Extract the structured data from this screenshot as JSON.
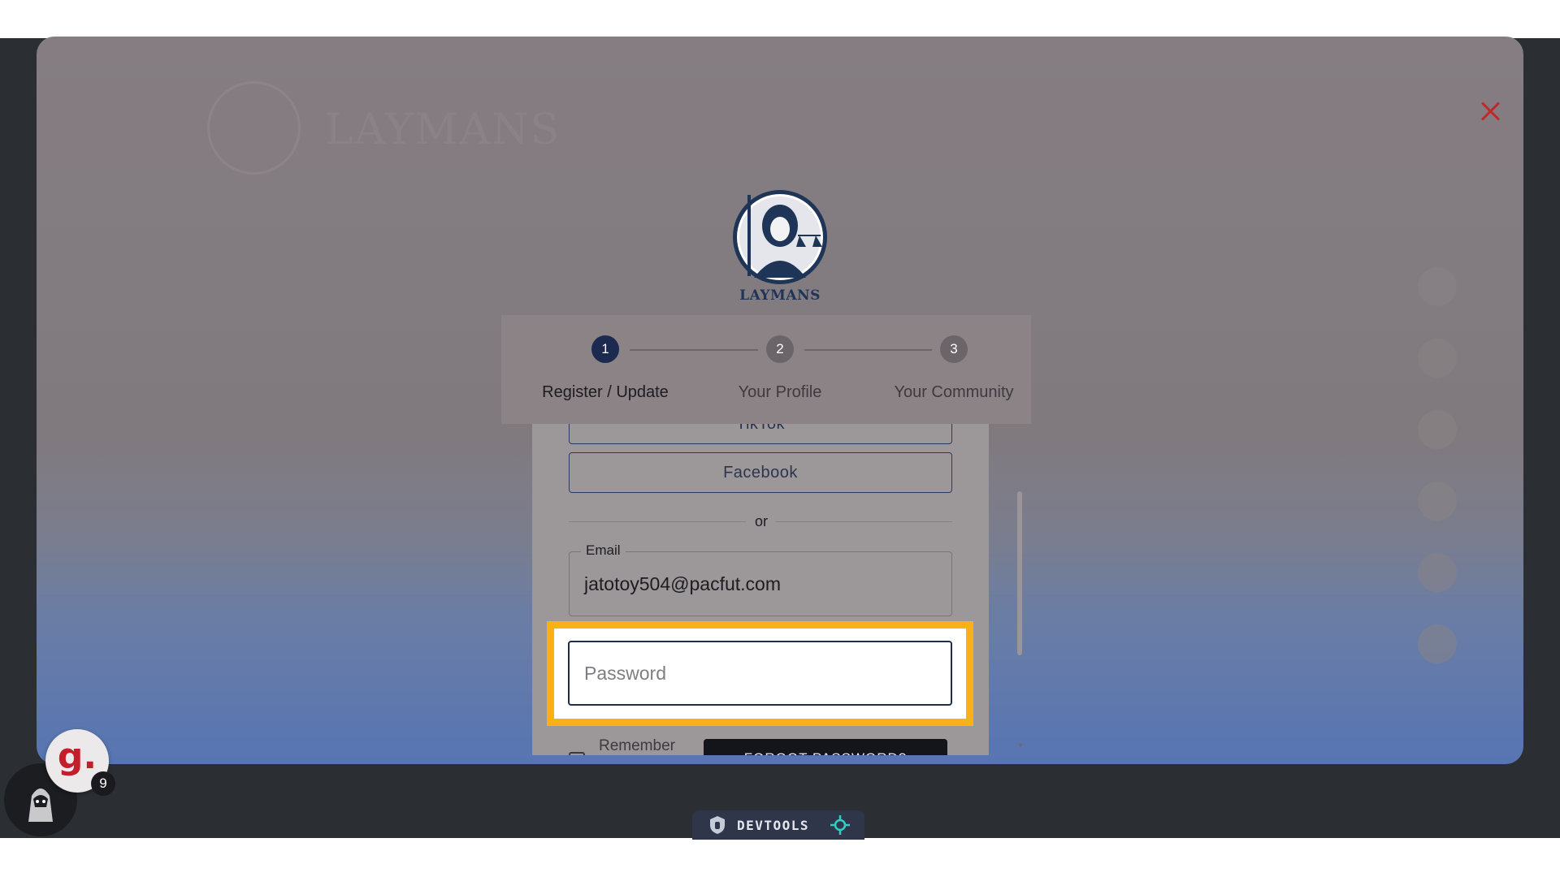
{
  "logo": {
    "text": "LAYMANS"
  },
  "background": {
    "brand_text": "LAYMANS"
  },
  "stepper": {
    "steps": [
      {
        "number": "1",
        "label": "Register / Update",
        "active": true
      },
      {
        "number": "2",
        "label": "Your Profile",
        "active": false
      },
      {
        "number": "3",
        "label": "Your Community",
        "active": false
      }
    ]
  },
  "form": {
    "tiktok_label": "TikTok",
    "facebook_label": "Facebook",
    "divider_text": "or",
    "email_label": "Email",
    "email_value": "jatotoy504@pacfut.com",
    "password_placeholder": "Password",
    "remember_label": "Remember",
    "forgot_label": "FORGOT PASSWORD?"
  },
  "grammarly": {
    "glyph": "g.",
    "count": "9"
  },
  "devtools": {
    "label": "DEVTOOLS"
  },
  "colors": {
    "step_active": "#1b2a4e",
    "step_inactive": "#6b6468",
    "highlight": "#fbb017",
    "close": "#c0282b"
  }
}
